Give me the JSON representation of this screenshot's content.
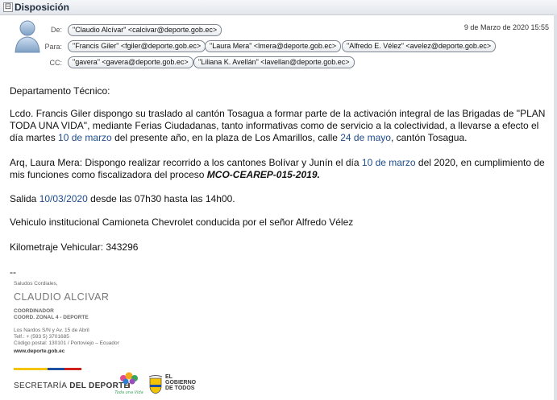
{
  "window": {
    "title": "Disposición",
    "collapse_glyph": "⊟"
  },
  "header": {
    "from_label": "De:",
    "to_label": "Para:",
    "cc_label": "CC:",
    "date": "9 de Marzo de 2020 15:55",
    "from": "\"Claudio Alcívar\" <calcivar@deporte.gob.ec>",
    "to": [
      "\"Francis Giler\" <fgiler@deporte.gob.ec>",
      "\"Laura Mera\" <lmera@deporte.gob.ec>",
      "\"Alfredo E. Vélez\" <avelez@deporte.gob.ec>"
    ],
    "cc": [
      "\"gavera\" <gavera@deporte.gob.ec>",
      "\"Liliana K. Avellán\" <lavellan@deporte.gob.ec>"
    ]
  },
  "body": {
    "greeting": "Departamento Técnico:",
    "p1_a": "Lcdo. Francis Giler dispongo su traslado al cantón Tosagua a formar parte de la activación integral de las Brigadas de \"PLAN TODA UNA VIDA\", mediante Ferias Ciudadanas, tanto informativas como de servicio a la colectividad, a llevarse a efecto el día martes ",
    "p1_link1": "10  de marzo",
    "p1_b": " del presente año, en la  plaza de Los Amarillos, calle ",
    "p1_link2": "24 de mayo",
    "p1_c": ", cantón Tosagua.",
    "p2_a": "Arq, Laura Mera: Dispongo realizar recorrido a los cantones Bolívar y Junín el día ",
    "p2_link": "10 de marzo",
    "p2_b": " del 2020, en cumplimiento de mis funciones como fiscalizadora del proceso  ",
    "p2_code": "MCO-CEAREP-015-2019.",
    "p3_a": "Salida ",
    "p3_link": "10/03/2020",
    "p3_b": " desde las 07h30 hasta las 14h00.",
    "p4": "Vehiculo institucional Camioneta Chevrolet conducida por el señor Alfredo Vélez",
    "p5": "Kilometraje Vehicular: 343296",
    "sig_sep": "--"
  },
  "signature": {
    "greeting": "Saludos Cordiales,",
    "name": "CLAUDIO ALCIVAR",
    "role1": "COORDINADOR",
    "role2": "COORD. ZONAL 4 - DEPORTE",
    "addr1": "Los Nardos S/N y Av. 15 de Abril",
    "phone": "Telf.: + (593 5) 3701685",
    "addr2": "Código postal: 130101 / Portoviejo – Ecuador",
    "web": "www.deporte.gob.ec",
    "secretaria_a": "SECRETARÍA",
    "secretaria_b": " DEL DEPORTE",
    "gob1": "EL",
    "gob2": "GOBIERNO",
    "gob3": "DE TODOS",
    "vida_text": "Toda una Vida"
  },
  "colors": {
    "link": "#1d4c8c",
    "flag_yellow": "#f5c400",
    "flag_blue": "#1f4fa0",
    "flag_red": "#d0201c"
  }
}
